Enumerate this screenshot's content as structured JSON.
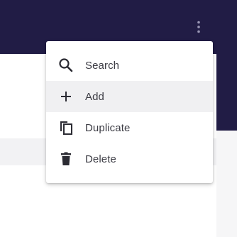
{
  "colors": {
    "header_bg": "#211c45",
    "menu_hover": "#f0f0f2",
    "text": "#3c3c44",
    "icon": "#2b2b33"
  },
  "header": {
    "more_icon": "more-vert-icon"
  },
  "menu": {
    "items": [
      {
        "label": "Search",
        "icon": "search-icon",
        "hovered": false
      },
      {
        "label": "Add",
        "icon": "plus-icon",
        "hovered": true
      },
      {
        "label": "Duplicate",
        "icon": "duplicate-icon",
        "hovered": false
      },
      {
        "label": "Delete",
        "icon": "trash-icon",
        "hovered": false
      }
    ]
  }
}
